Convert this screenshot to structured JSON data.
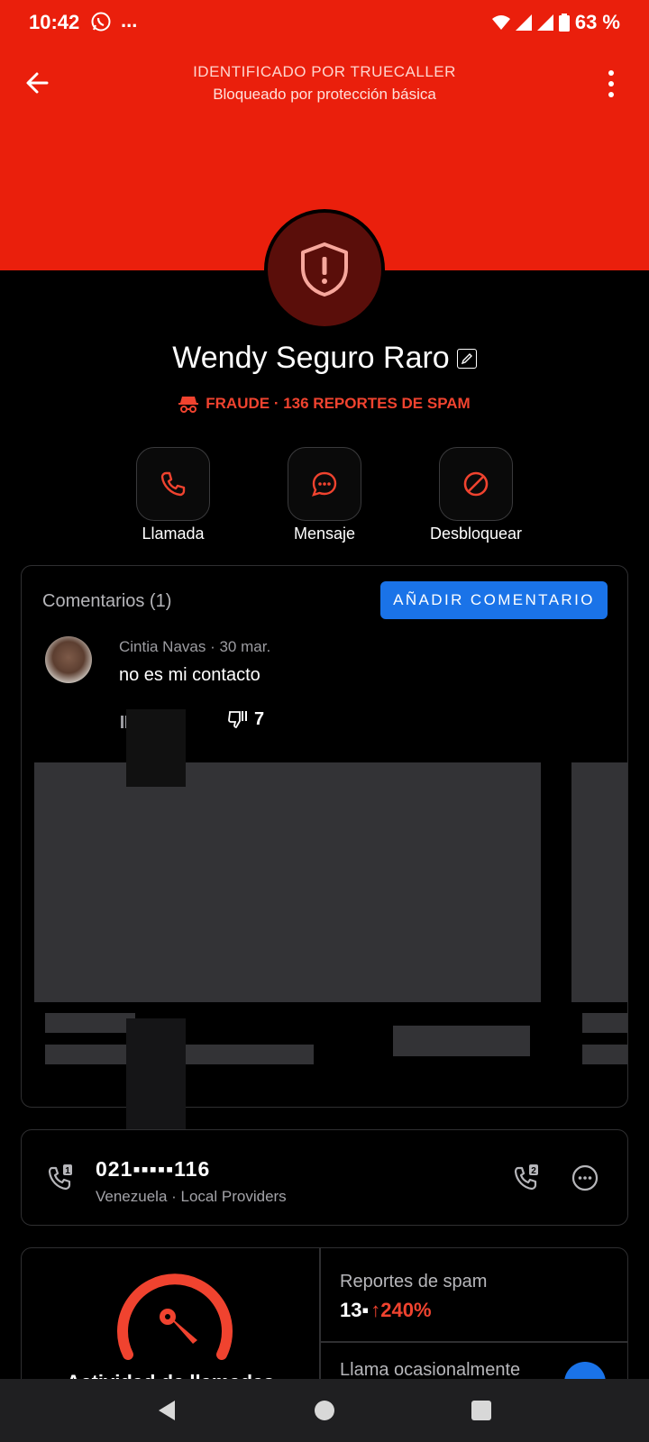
{
  "status_bar": {
    "time": "10:42",
    "more": "...",
    "battery": "63 %"
  },
  "header": {
    "title": "IDENTIFICADO POR TRUECALLER",
    "subtitle": "Bloqueado por protección básica"
  },
  "contact": {
    "name": "Wendy Seguro Raro",
    "fraud_label": "FRAUDE · 136 REPORTES DE SPAM"
  },
  "actions": [
    {
      "label": "Llamada",
      "icon": "phone-icon"
    },
    {
      "label": "Mensaje",
      "icon": "message-icon"
    },
    {
      "label": "Desbloquear",
      "icon": "unblock-icon"
    }
  ],
  "comments": {
    "title": "Comentarios (1)",
    "add_button": "AÑADIR COMENTARIO",
    "items": [
      {
        "author_date": "Cintia Navas · 30 mar.",
        "text": "no es mi contacto",
        "dislikes": "7"
      }
    ]
  },
  "phone": {
    "number": "021▪▪▪▪▪116",
    "subtitle": "Venezuela · Local Providers"
  },
  "stats": {
    "activity_label": "Actividad de llamadas",
    "spam_label": "Reportes de spam",
    "spam_value": "13▪",
    "spam_growth": "↑240%",
    "call_frequency": "Llama ocasionalmente"
  },
  "colors": {
    "header_red": "#ea1f0c",
    "alert_red": "#f0432f",
    "accent_blue": "#1a73e8"
  }
}
